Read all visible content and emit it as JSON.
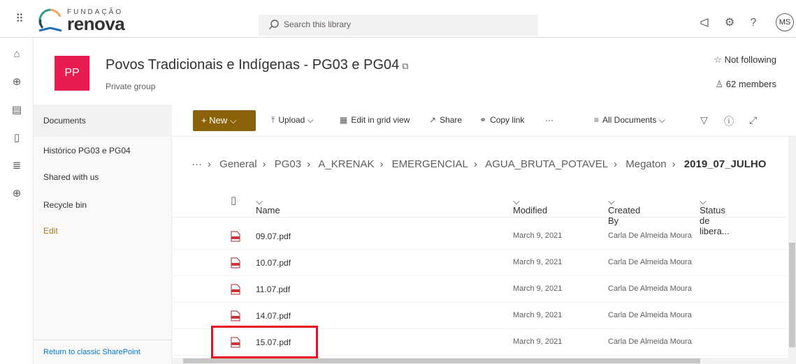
{
  "topbar": {
    "app_launcher_icon": "waffle-icon",
    "logo_top": "FUNDAÇÃO",
    "logo_main": "renova",
    "search_placeholder": "Search this library",
    "icons": [
      "megaphone-icon",
      "gear-icon",
      "help-icon"
    ],
    "help_glyph": "?",
    "avatar_initials": "MS"
  },
  "rail": [
    "home-icon",
    "globe-icon",
    "news-icon",
    "file-icon",
    "list-icon",
    "add-icon"
  ],
  "header": {
    "logo_initials": "PP",
    "title": "Povos Tradicionais e Indígenas - PG03 e PG04",
    "subtitle": "Private group",
    "follow": "Not following",
    "members": "62 members"
  },
  "nav": {
    "items": [
      "Documents",
      "Histórico PG03 e PG04",
      "Shared with us",
      "Recycle bin",
      "Edit"
    ],
    "bottom": "Return to classic SharePoint"
  },
  "commands": {
    "new": "New",
    "upload": "Upload",
    "edit_grid": "Edit in grid view",
    "share": "Share",
    "copy_link": "Copy link",
    "more": "···",
    "view": "All Documents"
  },
  "breadcrumb": {
    "ellipsis": "···",
    "items": [
      "General",
      "PG03",
      "A_KRENAK",
      "EMERGENCIAL",
      "AGUA_BRUTA_POTAVEL",
      "Megaton"
    ],
    "current": "2019_07_JULHO"
  },
  "columns": {
    "name": "Name",
    "modified": "Modified",
    "created_by": "Created By",
    "status": "Status de libera..."
  },
  "files": [
    {
      "name": "09.07.pdf",
      "modified": "March 9, 2021",
      "created_by": "Carla De Almeida Moura"
    },
    {
      "name": "10.07.pdf",
      "modified": "March 9, 2021",
      "created_by": "Carla De Almeida Moura"
    },
    {
      "name": "11.07.pdf",
      "modified": "March 9, 2021",
      "created_by": "Carla De Almeida Moura"
    },
    {
      "name": "14.07.pdf",
      "modified": "March 9, 2021",
      "created_by": "Carla De Almeida Moura"
    },
    {
      "name": "15.07.pdf",
      "modified": "March 9, 2021",
      "created_by": "Carla De Almeida Moura"
    }
  ],
  "colors": {
    "brand_gold": "#8a6308",
    "group_logo": "#e81c4f",
    "highlight": "#e81123"
  }
}
